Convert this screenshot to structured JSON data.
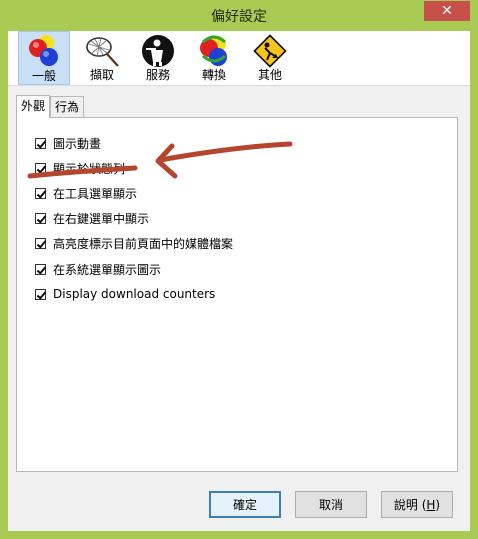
{
  "window": {
    "title": "偏好設定",
    "close_glyph": "✕"
  },
  "toolbar": {
    "items": [
      {
        "label": "一般",
        "icon": "general-balls-icon",
        "selected": true
      },
      {
        "label": "擷取",
        "icon": "net-capture-icon",
        "selected": false
      },
      {
        "label": "服務",
        "icon": "waiter-service-icon",
        "selected": false
      },
      {
        "label": "轉換",
        "icon": "convert-balls-icon",
        "selected": false
      },
      {
        "label": "其他",
        "icon": "warning-sign-icon",
        "selected": false
      }
    ]
  },
  "tabs": [
    {
      "label": "外觀",
      "active": true
    },
    {
      "label": "行為",
      "active": false
    }
  ],
  "options": [
    {
      "label": "圖示動畫",
      "checked": true
    },
    {
      "label": "顯示於狀態列",
      "checked": true
    },
    {
      "label": "在工具選單顯示",
      "checked": true
    },
    {
      "label": "在右鍵選單中顯示",
      "checked": true
    },
    {
      "label": "高亮度標示目前頁面中的媒體檔案",
      "checked": true
    },
    {
      "label": "在系統選單顯示圖示",
      "checked": true
    },
    {
      "label": "Display download counters",
      "checked": true
    }
  ],
  "buttons": {
    "ok": "確定",
    "cancel": "取消",
    "help_prefix": "說明 (",
    "help_key": "H",
    "help_suffix": ")"
  },
  "annotation": {
    "color": "#b5452b",
    "target_option": "顯示於狀態列"
  }
}
